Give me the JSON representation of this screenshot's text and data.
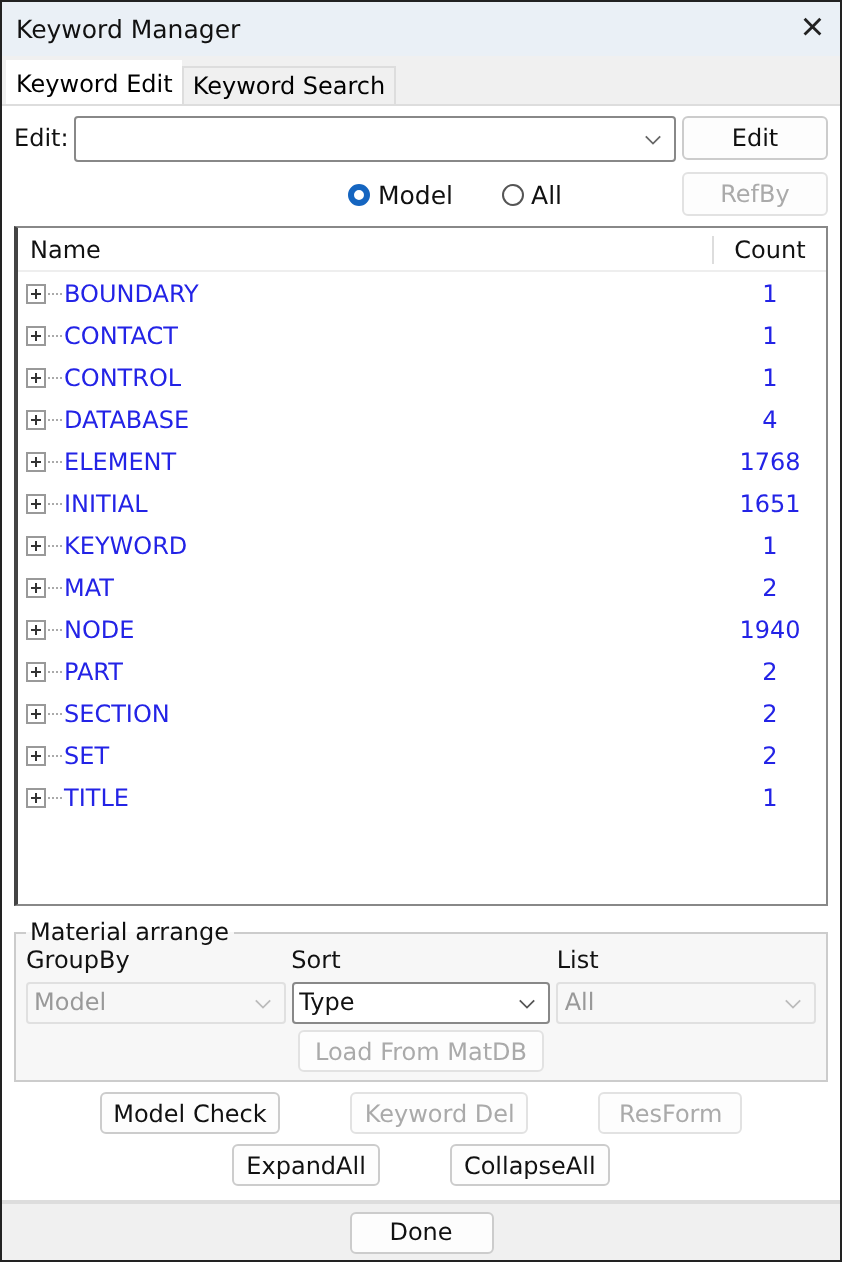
{
  "window": {
    "title": "Keyword Manager",
    "close": "×"
  },
  "tabs": [
    {
      "label": "Keyword Edit",
      "selected": true
    },
    {
      "label": "Keyword Search",
      "selected": false
    }
  ],
  "edit": {
    "label": "Edit:",
    "button": {
      "label": "Edit",
      "disabled": false
    }
  },
  "scope": [
    {
      "label": "Model",
      "selected": true
    },
    {
      "label": "All",
      "selected": false
    }
  ],
  "refby": {
    "label": "RefBy",
    "disabled": true
  },
  "tree": {
    "columns": [
      "Name",
      "Count"
    ],
    "rows": [
      {
        "name": "BOUNDARY",
        "count": "1"
      },
      {
        "name": "CONTACT",
        "count": "1"
      },
      {
        "name": "CONTROL",
        "count": "1"
      },
      {
        "name": "DATABASE",
        "count": "4"
      },
      {
        "name": "ELEMENT",
        "count": "1768"
      },
      {
        "name": "INITIAL",
        "count": "1651"
      },
      {
        "name": "KEYWORD",
        "count": "1"
      },
      {
        "name": "MAT",
        "count": "2"
      },
      {
        "name": "NODE",
        "count": "1940"
      },
      {
        "name": "PART",
        "count": "2"
      },
      {
        "name": "SECTION",
        "count": "2"
      },
      {
        "name": "SET",
        "count": "2"
      },
      {
        "name": "TITLE",
        "count": "1"
      }
    ]
  },
  "material": {
    "title": "Material arrange",
    "selects": [
      {
        "label": "GroupBy",
        "value": "Model",
        "disabled": true
      },
      {
        "label": "Sort",
        "value": "Type",
        "disabled": false
      },
      {
        "label": "List",
        "value": "All",
        "disabled": true
      }
    ],
    "load": {
      "label": "Load From MatDB",
      "disabled": true
    }
  },
  "buttons": [
    [
      {
        "label": "Model Check",
        "disabled": false
      },
      {
        "label": "Keyword Del",
        "disabled": true
      },
      {
        "label": "ResForm",
        "disabled": true
      }
    ],
    [
      {
        "label": "ExpandAll",
        "disabled": false
      },
      {
        "label": "CollapseAll",
        "disabled": false
      }
    ]
  ],
  "done": {
    "label": "Done",
    "disabled": false
  }
}
